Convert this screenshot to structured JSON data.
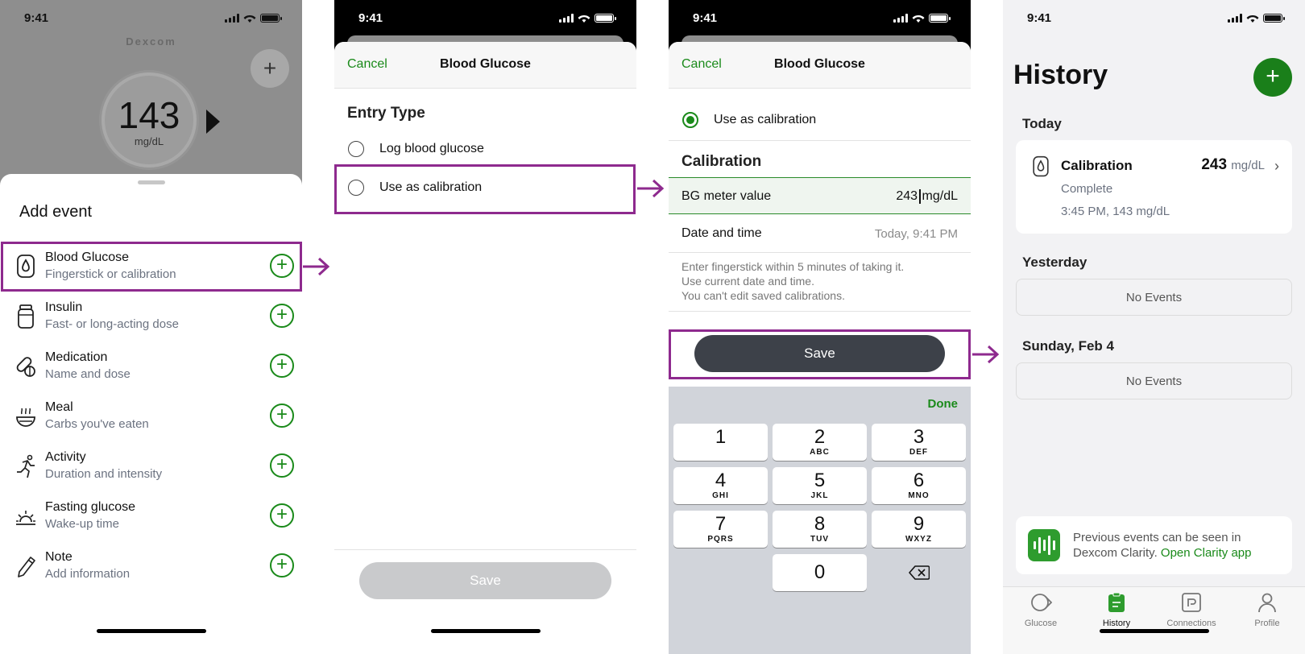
{
  "status_time": "9:41",
  "screen1": {
    "brand": "Dexcom",
    "glucose_value": "143",
    "glucose_unit": "mg/dL",
    "header_add": "+",
    "sheet_title": "Add event",
    "events": [
      {
        "title": "Blood Glucose",
        "subtitle": "Fingerstick or calibration",
        "icon": "blood-drop-icon"
      },
      {
        "title": "Insulin",
        "subtitle": "Fast- or long-acting dose",
        "icon": "insulin-vial-icon"
      },
      {
        "title": "Medication",
        "subtitle": "Name and dose",
        "icon": "pill-icon"
      },
      {
        "title": "Meal",
        "subtitle": "Carbs you've eaten",
        "icon": "meal-bowl-icon"
      },
      {
        "title": "Activity",
        "subtitle": "Duration and intensity",
        "icon": "running-icon"
      },
      {
        "title": "Fasting glucose",
        "subtitle": "Wake-up time",
        "icon": "sunrise-icon"
      },
      {
        "title": "Note",
        "subtitle": "Add information",
        "icon": "pencil-icon"
      }
    ],
    "add_glyph": "+"
  },
  "screen2": {
    "cancel": "Cancel",
    "title": "Blood Glucose",
    "section": "Entry Type",
    "options": [
      "Log blood glucose",
      "Use as calibration"
    ],
    "save": "Save"
  },
  "screen3": {
    "cancel": "Cancel",
    "title": "Blood Glucose",
    "selected_option": "Use as calibration",
    "section": "Calibration",
    "bg_label": "BG meter value",
    "bg_value": "243",
    "bg_unit": "mg/dL",
    "dt_label": "Date and time",
    "dt_value": "Today, 9:41 PM",
    "note_lines": [
      "Enter fingerstick within 5 minutes of taking it.",
      "Use current date and time.",
      "You can't edit saved calibrations."
    ],
    "save": "Save",
    "keyboard": {
      "done": "Done",
      "keys": [
        {
          "n": "1",
          "s": ""
        },
        {
          "n": "2",
          "s": "ABC"
        },
        {
          "n": "3",
          "s": "DEF"
        },
        {
          "n": "4",
          "s": "GHI"
        },
        {
          "n": "5",
          "s": "JKL"
        },
        {
          "n": "6",
          "s": "MNO"
        },
        {
          "n": "7",
          "s": "PQRS"
        },
        {
          "n": "8",
          "s": "TUV"
        },
        {
          "n": "9",
          "s": "WXYZ"
        }
      ],
      "zero": "0"
    }
  },
  "screen4": {
    "title": "History",
    "add": "+",
    "today": "Today",
    "entry": {
      "title": "Calibration",
      "value": "243",
      "unit": "mg/dL",
      "status": "Complete",
      "detail": "3:45 PM, 143 mg/dL"
    },
    "yesterday": "Yesterday",
    "no_events": "No Events",
    "sunday": "Sunday, Feb 4",
    "clarity_line1": "Previous events can be seen in",
    "clarity_line2": "Dexcom Clarity.",
    "clarity_link": "Open Clarity app",
    "tabs": [
      "Glucose",
      "History",
      "Connections",
      "Profile"
    ]
  },
  "colors": {
    "accent_green": "#1a8a1a",
    "highlight_purple": "#8e2a8e",
    "save_dark": "#3d4149"
  }
}
